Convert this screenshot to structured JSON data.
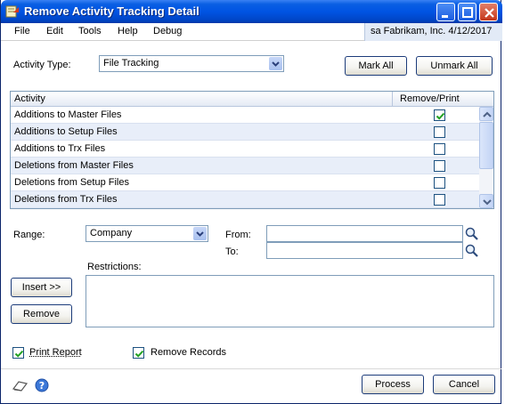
{
  "window": {
    "title": "Remove Activity Tracking Detail",
    "accent": "#0054e3"
  },
  "menu": {
    "items": [
      "File",
      "Edit",
      "Tools",
      "Help",
      "Debug"
    ],
    "user_info": "sa  Fabrikam, Inc.  4/12/2017"
  },
  "activity_type": {
    "label": "Activity Type:",
    "value": "File Tracking"
  },
  "buttons": {
    "mark_all": "Mark All",
    "unmark_all": "Unmark All",
    "insert": "Insert >>",
    "remove": "Remove",
    "process": "Process",
    "cancel": "Cancel"
  },
  "grid": {
    "columns": [
      "Activity",
      "Remove/Print"
    ],
    "rows": [
      {
        "activity": "Additions to Master Files",
        "checked": true
      },
      {
        "activity": "Additions to Setup Files",
        "checked": false
      },
      {
        "activity": "Additions to Trx Files",
        "checked": false
      },
      {
        "activity": "Deletions from Master Files",
        "checked": false
      },
      {
        "activity": "Deletions from Setup Files",
        "checked": false
      },
      {
        "activity": "Deletions from Trx Files",
        "checked": false
      }
    ]
  },
  "range": {
    "label": "Range:",
    "value": "Company",
    "from_label": "From:",
    "to_label": "To:",
    "from_value": "",
    "to_value": ""
  },
  "restrictions": {
    "label": "Restrictions:"
  },
  "options": {
    "print_report": {
      "label": "Print Report",
      "checked": true
    },
    "remove_records": {
      "label": "Remove Records",
      "checked": true
    }
  },
  "icons": {
    "app": "tracking-app-icon",
    "note": "note-icon",
    "help": "help-icon",
    "lookup": "magnifier-icon"
  }
}
